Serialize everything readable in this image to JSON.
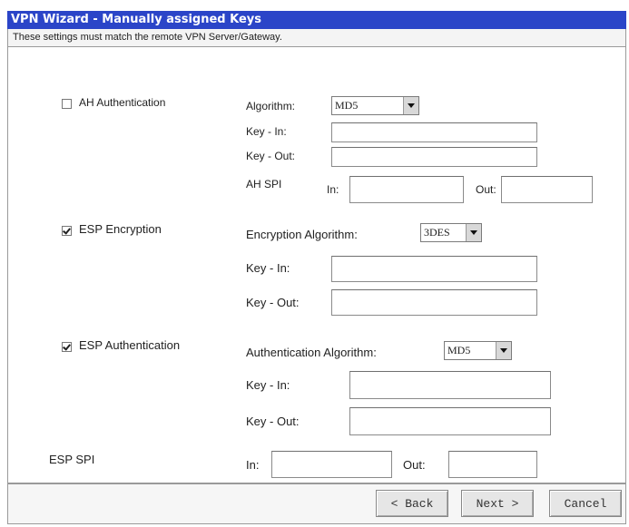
{
  "header": {
    "title": "VPN Wizard - Manually assigned Keys",
    "subtitle": "These settings must match the remote VPN Server/Gateway."
  },
  "ah": {
    "label": "AH Authentication",
    "checked": false,
    "algorithm_label": "Algorithm:",
    "algorithm_value": "MD5",
    "key_in_label": "Key - In:",
    "key_in_value": "",
    "key_out_label": "Key - Out:",
    "key_out_value": "",
    "spi_label": "AH SPI",
    "spi_in_label": "In:",
    "spi_in_value": "",
    "spi_out_label": "Out:",
    "spi_out_value": ""
  },
  "esp_encryption": {
    "label": "ESP Encryption",
    "checked": true,
    "algorithm_label": "Encryption Algorithm:",
    "algorithm_value": "3DES",
    "key_in_label": "Key - In:",
    "key_in_value": "",
    "key_out_label": "Key - Out:",
    "key_out_value": ""
  },
  "esp_authentication": {
    "label": "ESP Authentication",
    "checked": true,
    "algorithm_label": "Authentication Algorithm:",
    "algorithm_value": "MD5",
    "key_in_label": "Key - In:",
    "key_in_value": "",
    "key_out_label": "Key - Out:",
    "key_out_value": ""
  },
  "esp_spi": {
    "label": "ESP SPI",
    "in_label": "In:",
    "in_value": "",
    "out_label": "Out:",
    "out_value": ""
  },
  "buttons": {
    "back": "< Back",
    "next": "Next >",
    "cancel": "Cancel"
  }
}
